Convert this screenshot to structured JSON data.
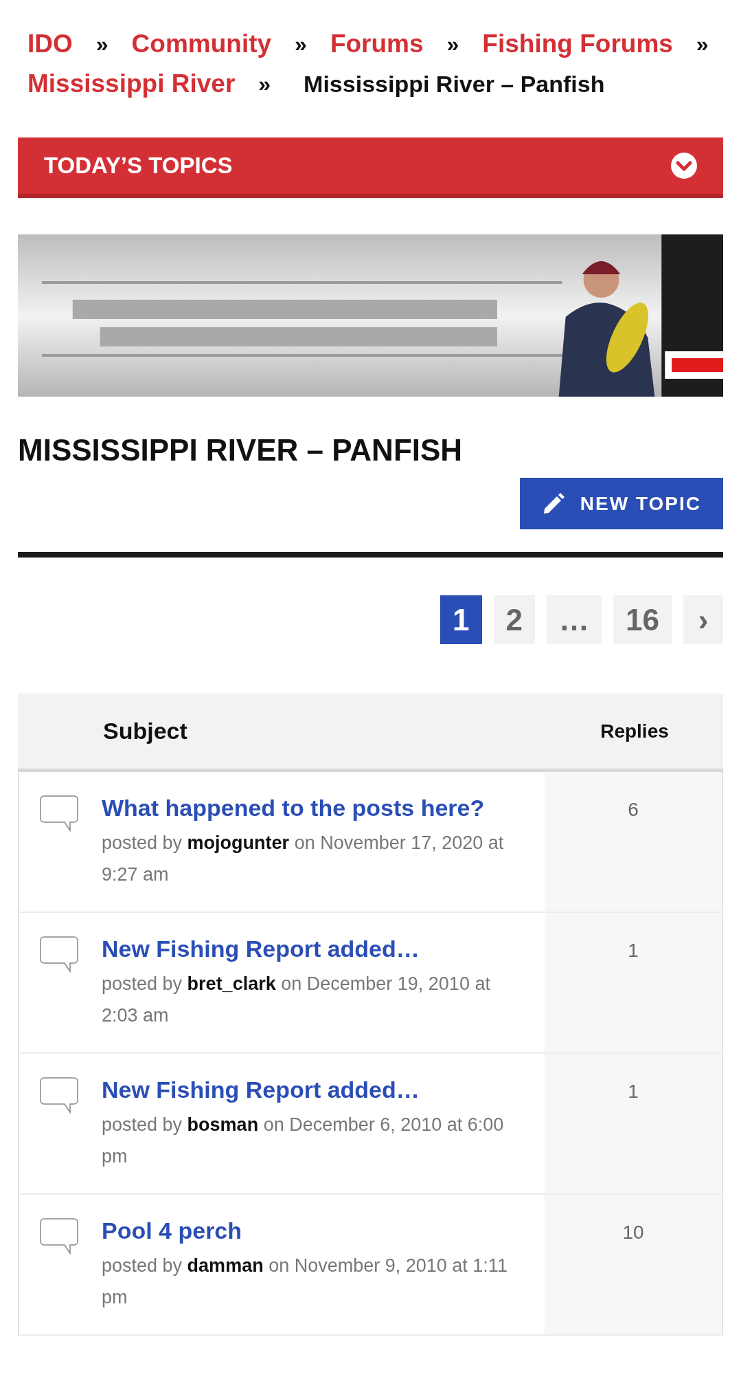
{
  "breadcrumb": {
    "links": [
      "IDO",
      "Community",
      "Forums",
      "Fishing Forums",
      "Mississippi River"
    ],
    "separator": "»",
    "current": "Mississippi River – Panfish"
  },
  "todays_topics": {
    "title": "TODAY’S TOPICS",
    "expanded": false
  },
  "forum": {
    "title": "MISSISSIPPI RIVER – PANFISH",
    "new_topic_button": "NEW TOPIC"
  },
  "pagination": [
    {
      "label": "1",
      "selected": true
    },
    {
      "label": "2",
      "selected": false
    },
    {
      "label": "…",
      "selected": false
    },
    {
      "label": "16",
      "selected": false
    },
    {
      "label": "›",
      "selected": false
    }
  ],
  "table": {
    "columns": [
      "Subject",
      "Replies"
    ],
    "rows": [
      {
        "title": "What happened to the posts here?",
        "prefix": "posted by",
        "author": "mojogunter",
        "date": "on November 17, 2020 at 9:27 am",
        "replies": "6"
      },
      {
        "title": "New Fishing Report added…",
        "prefix": "posted by",
        "author": "bret_clark",
        "date": "on December 19, 2010 at 2:03 am",
        "replies": "1"
      },
      {
        "title": "New Fishing Report added…",
        "prefix": "posted by",
        "author": "bosman",
        "date": "on December 6, 2010 at 6:00 pm",
        "replies": "1"
      },
      {
        "title": "Pool 4 perch",
        "prefix": "posted by",
        "author": "damman",
        "date": "on November 9, 2010 at 1:11 pm",
        "replies": "10"
      }
    ]
  }
}
